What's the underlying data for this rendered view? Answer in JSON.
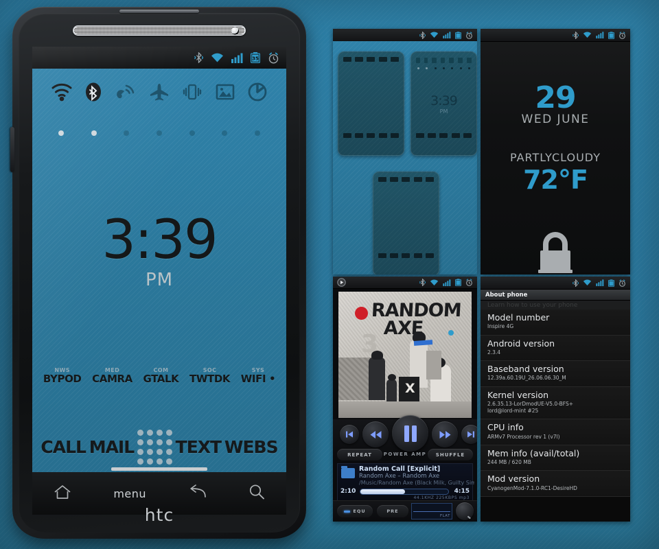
{
  "phone": {
    "brand_logo": "htc",
    "status_bar": {
      "icons": [
        "bluetooth-icon",
        "wifi-icon",
        "signal-icon",
        "battery-icon",
        "alarm-icon"
      ],
      "battery_level": "35"
    },
    "toggles": [
      {
        "name": "wifi-toggle",
        "icon": "wifi-icon",
        "active": true
      },
      {
        "name": "bluetooth-toggle",
        "icon": "bluetooth-icon",
        "active": true
      },
      {
        "name": "data-toggle",
        "icon": "satellite-icon",
        "active": false
      },
      {
        "name": "airplane-toggle",
        "icon": "airplane-icon",
        "active": false
      },
      {
        "name": "vibrate-toggle",
        "icon": "vibrate-icon",
        "active": false
      },
      {
        "name": "brightness-toggle",
        "icon": "image-icon",
        "active": false
      },
      {
        "name": "power-toggle",
        "icon": "power-icon",
        "active": false
      }
    ],
    "clock": {
      "time": "3:39",
      "ampm": "PM"
    },
    "quick_links": [
      {
        "top": "NWS",
        "label": "BYPOD"
      },
      {
        "top": "MED",
        "label": "CAMRA"
      },
      {
        "top": "COM",
        "label": "GTALK"
      },
      {
        "top": "SOC",
        "label": "TWTDK"
      },
      {
        "top": "SYS",
        "label": "WIFI •"
      }
    ],
    "dock": [
      {
        "label": "CALL"
      },
      {
        "label": "MAIL"
      },
      {
        "label": "",
        "icon": "app-drawer-icon"
      },
      {
        "label": "TEXT"
      },
      {
        "label": "WEBS"
      }
    ],
    "nav": {
      "home": "home-icon",
      "menu_label": "menu",
      "back": "back-icon",
      "search": "search-icon"
    }
  },
  "overview": {
    "title": "homescreen-overview",
    "panels": [
      {
        "name": "panel-left"
      },
      {
        "name": "panel-center",
        "time": "3:39",
        "ampm": "PM"
      },
      {
        "name": "panel-right"
      }
    ]
  },
  "lockscreen": {
    "day_number": "29",
    "date": "WED JUNE",
    "condition": "PARTLYCLOUDY",
    "temperature": "72°F",
    "lock_icon": "lock-icon",
    "accent_color": "#2f9ccb"
  },
  "music": {
    "app_name": "POWER AMP",
    "album_art": {
      "title_line1": "RANDOM",
      "title_line2": "AXE",
      "number": "3",
      "x_mark": "X"
    },
    "controls": {
      "prev_track": "previous-track-icon",
      "rewind": "rewind-icon",
      "play_pause": "pause-icon",
      "fast_forward": "fast-forward-icon",
      "next_track": "next-track-icon",
      "repeat_label": "REPEAT",
      "shuffle_label": "SHUFFLE"
    },
    "track": {
      "title": "Random Call [Explicit]",
      "artist": "Random Axe – Random Axe",
      "path": "/Music/Random Axe (Black Milk, Guilty Sim",
      "elapsed": "2:10",
      "total": "4:15",
      "progress_percent": 51,
      "format": "44.1KHZ   225KBPS   mp3"
    },
    "eq": {
      "equ_label": "EQU",
      "pre_label": "PRE",
      "preset": "FLAT"
    }
  },
  "about_phone": {
    "title": "About phone",
    "ghost_row": "Learn how to use your phone",
    "rows": [
      {
        "label": "Model number",
        "value": "Inspire 4G"
      },
      {
        "label": "Android version",
        "value": "2.3.4"
      },
      {
        "label": "Baseband version",
        "value": "12.39a.60.19U_26.06.06.30_M"
      },
      {
        "label": "Kernel version",
        "value": "2.6.35.13-LorDmodUE-V5.0-BFS+\nlord@lord-mint #25"
      },
      {
        "label": "CPU info",
        "value": "ARMv7 Processor rev 1 (v7l)"
      },
      {
        "label": "Mem info (avail/total)",
        "value": "244 MB / 620 MB"
      },
      {
        "label": "Mod version",
        "value": "CyanogenMod-7.1.0-RC1-DesireHD"
      }
    ]
  }
}
